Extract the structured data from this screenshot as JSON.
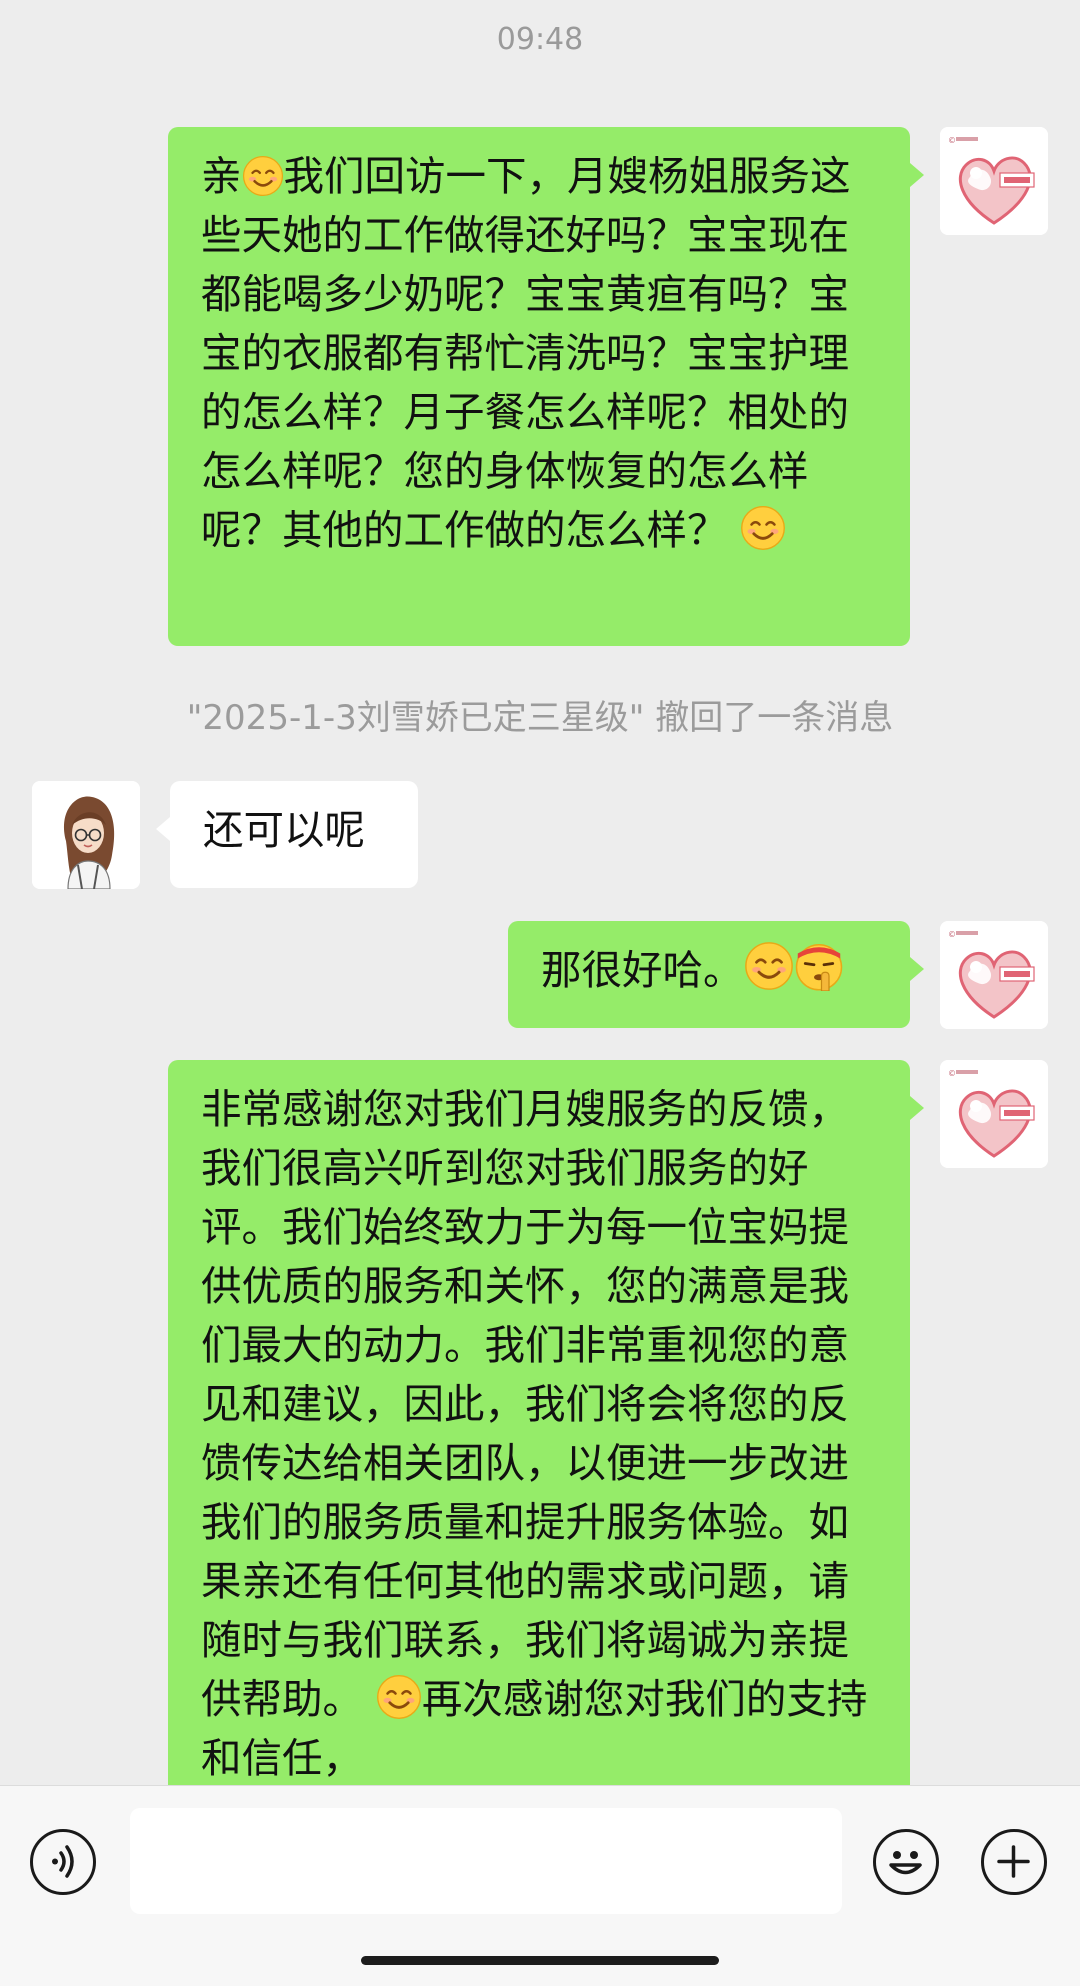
{
  "chat": {
    "timestamp": "09:48",
    "msg1": {
      "part1": "亲",
      "part2": "我们回访一下，月嫂杨姐服务这些天她的工作做得还好吗？宝宝现在都能喝多少奶呢？宝宝黄疸有吗？宝宝的衣服都有帮忙清洗吗？宝宝护理的怎么样？月子餐怎么样呢？相处的怎么样呢？您的身体恢复的怎么样呢？其他的工作做的怎么样？"
    },
    "recall_notice": "\"2025-1-3刘雪娇已定三星级\" 撤回了一条消息",
    "msg2": {
      "text": "还可以呢"
    },
    "msg3": {
      "text": "那很好哈。"
    },
    "msg4": {
      "part1": "非常感谢您对我们月嫂服务的反馈，我们很高兴听到您对我们服务的好评。我们始终致力于为每一位宝妈提供优质的服务和关怀，您的满意是我们最大的动力。我们非常重视您的意见和建议，因此，我们将会将您的反馈传达给相关团队，以便进一步改进我们的服务质量和提升服务体验。如果亲还有任何其他的需求或问题，请随时与我们联系，我们将竭诚为亲提供帮助。",
      "part2": "再次感谢您对我们的支持和信任，"
    }
  },
  "icons": {
    "smile": "smiling-face-emoji",
    "shush": "shushing-face-emoji",
    "voice": "voice-input-icon",
    "emoji": "emoji-icon",
    "plus": "plus-icon"
  },
  "colors": {
    "outgoing_bubble": "#95ec69",
    "incoming_bubble": "#ffffff",
    "background": "#ededed",
    "logo_heart": "#e57f8a"
  },
  "input": {
    "value": ""
  }
}
